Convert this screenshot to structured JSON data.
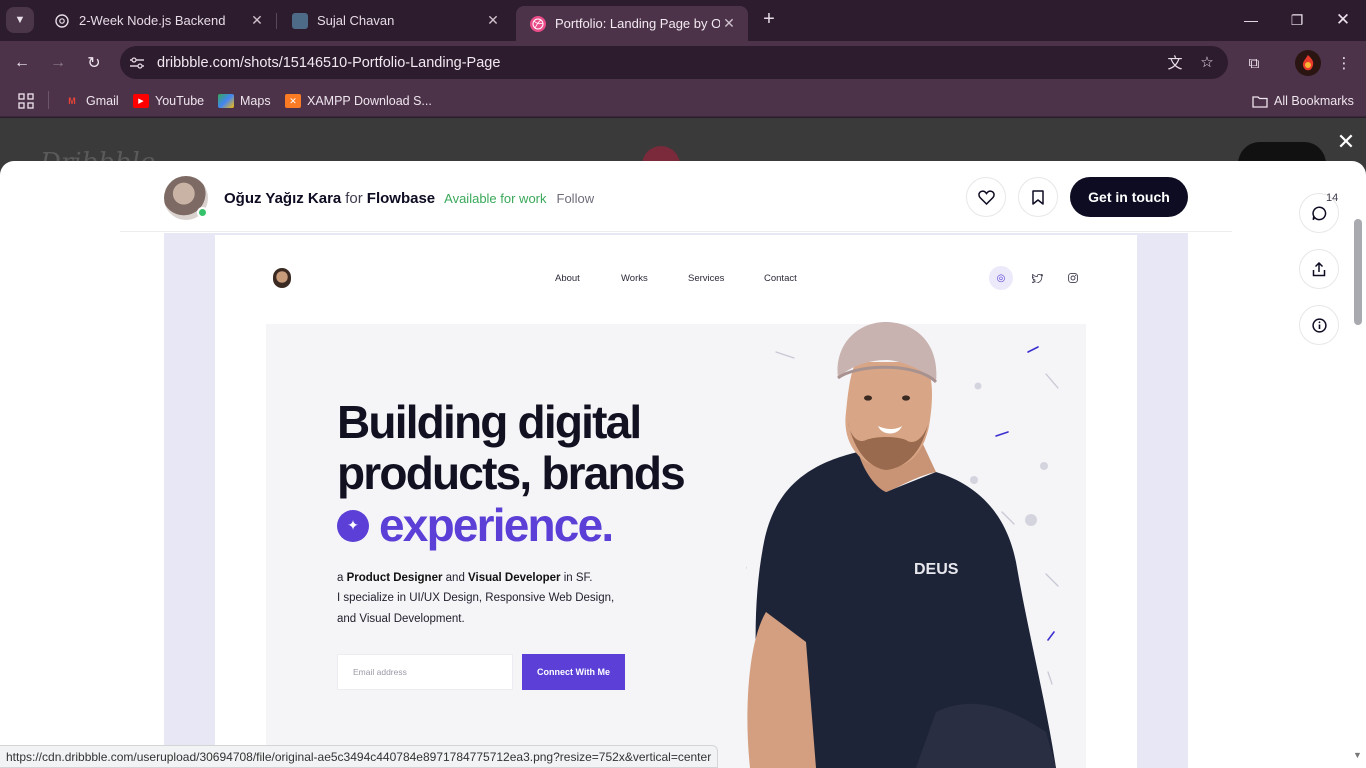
{
  "browser": {
    "tabs": [
      {
        "title": "2-Week Node.js Backend",
        "favicon": "chatgpt-icon",
        "active": false
      },
      {
        "title": "Sujal Chavan",
        "favicon": "profile-photo-icon",
        "active": false
      },
      {
        "title": "Portfolio: Landing Page by Oğuz",
        "favicon": "dribbble-icon",
        "active": true
      }
    ],
    "url": "dribbble.com/shots/15146510-Portfolio-Landing-Page",
    "bookmarks": [
      {
        "label": "Gmail",
        "icon": "gmail-icon",
        "color": "#ea4335"
      },
      {
        "label": "YouTube",
        "icon": "youtube-icon",
        "color": "#ff0000"
      },
      {
        "label": "Maps",
        "icon": "maps-icon",
        "color": "#34a853"
      },
      {
        "label": "XAMPP Download S...",
        "icon": "xampp-icon",
        "color": "#fb7a24"
      }
    ],
    "all_bookmarks": "All Bookmarks",
    "status_url": "https://cdn.dribbble.com/userupload/30694708/file/original-ae5c3494c440784e8971784775712ea3.png?resize=752x&vertical=center"
  },
  "shot": {
    "author_name": "Oğuz Yağız Kara",
    "for_text": "for",
    "team_name": "Flowbase",
    "availability": "Available for work",
    "follow_label": "Follow",
    "get_in_touch": "Get in touch",
    "comment_count": "14"
  },
  "design": {
    "nav": [
      "About",
      "Works",
      "Services",
      "Contact"
    ],
    "headline_line1": "Building digital",
    "headline_line2": "products, brands",
    "headline_accent": "experience.",
    "sub_line1_a": "a ",
    "sub_line1_b": "Product Designer",
    "sub_line1_c": " and ",
    "sub_line1_d": "Visual Developer",
    "sub_line1_e": " in SF.",
    "sub_line2": "I specialize in UI/UX Design, Responsive Web Design,",
    "sub_line3": "and Visual Development.",
    "email_placeholder": "Email address",
    "cta": "Connect With Me",
    "shirt_text": "DEUS",
    "accent_color": "#5b3fd6"
  }
}
